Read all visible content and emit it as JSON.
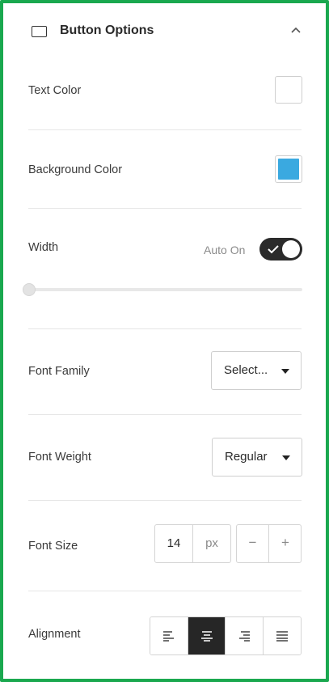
{
  "panel": {
    "title": "Button Options",
    "icons": {
      "section": "button-rectangle-icon",
      "collapse": "chevron-up-icon"
    },
    "colors": {
      "frame": "#1aa84f",
      "toggle_on": "#2b2b2b",
      "active_align": "#262626"
    }
  },
  "text_color": {
    "label": "Text Color",
    "value": "#ffffff"
  },
  "background_color": {
    "label": "Background Color",
    "value": "#3aa9e0"
  },
  "width": {
    "label": "Width",
    "auto_label": "Auto On",
    "auto_on": true,
    "slider_fraction": 0.0
  },
  "font_family": {
    "label": "Font Family",
    "value": "Select..."
  },
  "font_weight": {
    "label": "Font Weight",
    "value": "Regular"
  },
  "font_size": {
    "label": "Font Size",
    "value": "14",
    "unit": "px",
    "decrement": "−",
    "increment": "+"
  },
  "alignment": {
    "label": "Alignment",
    "options": [
      "left",
      "center",
      "right",
      "justify"
    ],
    "selected": "center",
    "icons": [
      "align-left-icon",
      "align-center-icon",
      "align-right-icon",
      "align-justify-icon"
    ]
  }
}
